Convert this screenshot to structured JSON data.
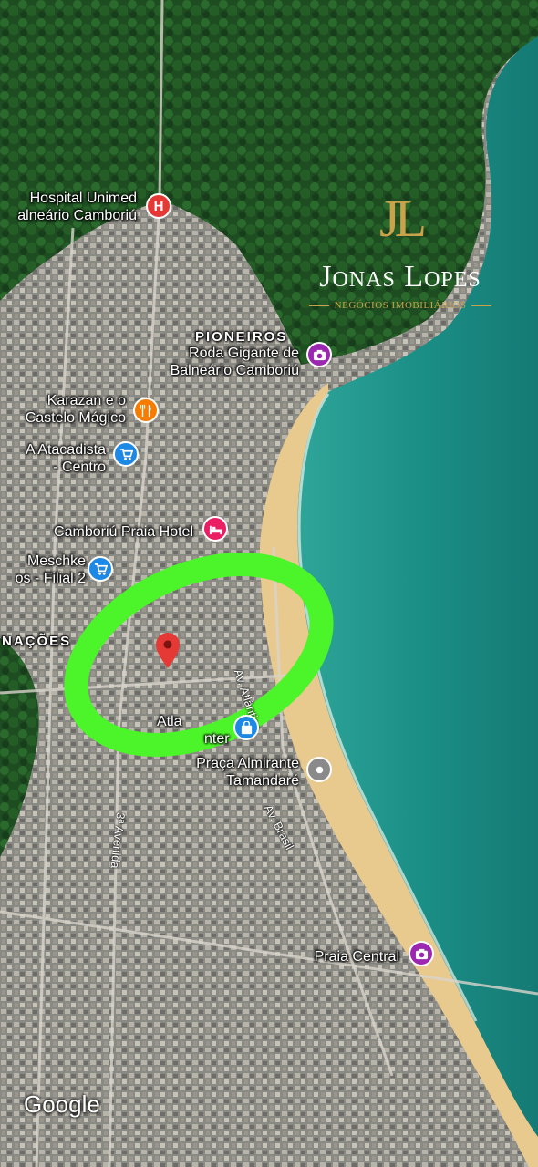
{
  "map": {
    "district_labels": [
      "PIONEIROS",
      "NAÇÕES"
    ],
    "places": [
      {
        "name_line1": "Hospital Unimed",
        "name_line2": "alneário Camboriú",
        "icon": "hospital-icon",
        "color": "#e53935"
      },
      {
        "name_line1": "Roda Gigante de",
        "name_line2": "Balneário Camboriú",
        "icon": "camera-icon",
        "color": "#9c27b0"
      },
      {
        "name_line1": "Karazan e o",
        "name_line2": "Castelo Mágico",
        "icon": "restaurant-icon",
        "color": "#f57c00"
      },
      {
        "name_line1": "A Atacadista",
        "name_line2": "- Centro",
        "icon": "shopping-cart-icon",
        "color": "#1e88e5"
      },
      {
        "name_line1": "Camboriú Praia Hotel",
        "name_line2": "",
        "icon": "bed-icon",
        "color": "#e91e63"
      },
      {
        "name_line1": "Meschke",
        "name_line2": "os - Filial 2",
        "icon": "shopping-cart-icon",
        "color": "#1e88e5"
      },
      {
        "name_line1": "Atla",
        "name_line2": "nter",
        "icon": "shopping-bag-icon",
        "color": "#1e88e5"
      },
      {
        "name_line1": "Praça Almirante",
        "name_line2": "Tamandaré",
        "icon": "place-icon",
        "color": "#8a8a8a"
      },
      {
        "name_line1": "Praia Central",
        "name_line2": "",
        "icon": "camera-icon",
        "color": "#9c27b0"
      }
    ],
    "streets": [
      "Av. Atlântica",
      "Av. Brasil",
      "3ª Avenida"
    ],
    "highlight_color": "#4cf52a",
    "marker_color": "#e53935",
    "attribution": "Google"
  },
  "logo": {
    "monogram": "JL",
    "name": "Jonas Lopes",
    "tagline": "NEGÓCIOS IMOBILIÁRIOS",
    "gold": "#c9a24a"
  }
}
